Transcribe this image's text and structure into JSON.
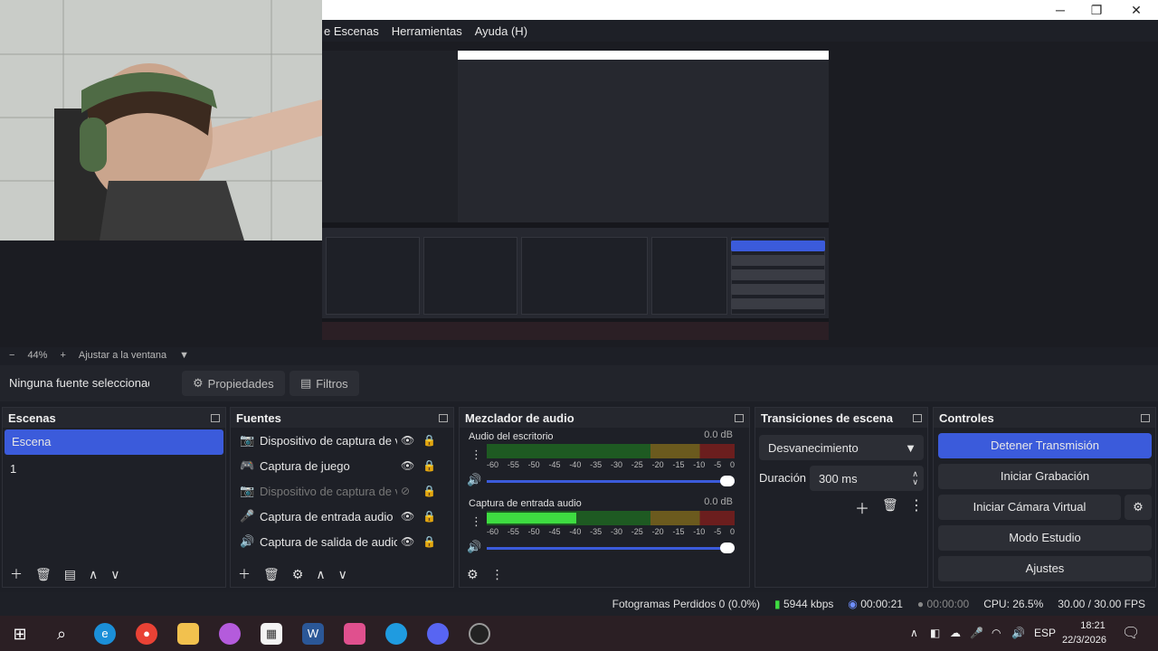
{
  "window": {
    "menu": [
      "e Escenas",
      "Herramientas",
      "Ayuda (H)"
    ],
    "controls": {
      "minimize": "─",
      "maximize": "❐",
      "close": "✕"
    }
  },
  "zoom": {
    "minus": "−",
    "value": "44%",
    "plus": "+",
    "fit_label": "Ajustar a la ventana"
  },
  "props_bar": {
    "no_selection": "Ninguna fuente seleccionada",
    "properties": "Propiedades",
    "filters": "Filtros"
  },
  "scenes": {
    "title": "Escenas",
    "items": [
      "Escena",
      "1"
    ],
    "selected_index": 0
  },
  "sources": {
    "title": "Fuentes",
    "items": [
      {
        "icon": "camera-icon",
        "glyph": "📷",
        "label": "Dispositivo de captura de v",
        "visible": true,
        "enabled": true
      },
      {
        "icon": "gamepad-icon",
        "glyph": "🎮",
        "label": "Captura de juego",
        "visible": true,
        "enabled": true
      },
      {
        "icon": "camera-icon",
        "glyph": "📷",
        "label": "Dispositivo de captura de v",
        "visible": false,
        "enabled": false
      },
      {
        "icon": "microphone-icon",
        "glyph": "🎤",
        "label": "Captura de entrada audio",
        "visible": true,
        "enabled": true
      },
      {
        "icon": "speaker-icon",
        "glyph": "🔊",
        "label": "Captura de salida de audio",
        "visible": true,
        "enabled": true
      }
    ]
  },
  "mixer": {
    "title": "Mezclador de audio",
    "channels": [
      {
        "name": "Audio del escritorio",
        "db": "0.0 dB",
        "level": 0
      },
      {
        "name": "Captura de entrada audio",
        "db": "0.0 dB",
        "level": 0.36
      }
    ],
    "ticks": [
      "-60",
      "-55",
      "-50",
      "-45",
      "-40",
      "-35",
      "-30",
      "-25",
      "-20",
      "-15",
      "-10",
      "-5",
      "0"
    ]
  },
  "transitions": {
    "title": "Transiciones de escena",
    "selected": "Desvanecimiento",
    "duration_label": "Duración",
    "duration_value": "300 ms"
  },
  "controls": {
    "title": "Controles",
    "stop_stream": "Detener Transmisión",
    "start_recording": "Iniciar Grabación",
    "virtual_cam": "Iniciar Cámara Virtual",
    "studio_mode": "Modo Estudio",
    "settings": "Ajustes"
  },
  "status": {
    "dropped": "Fotogramas Perdidos 0 (0.0%)",
    "bitrate": "5944 kbps",
    "stream_time": "00:00:21",
    "rec_time": "00:00:00",
    "cpu": "CPU: 26.5%",
    "fps": "30.00 / 30.00 FPS"
  },
  "taskbar": {
    "lang": "ESP",
    "time": "18:21",
    "date": "22/3/2026"
  },
  "colors": {
    "accent": "#3b5bdb",
    "meter_green": "#3edc41"
  }
}
